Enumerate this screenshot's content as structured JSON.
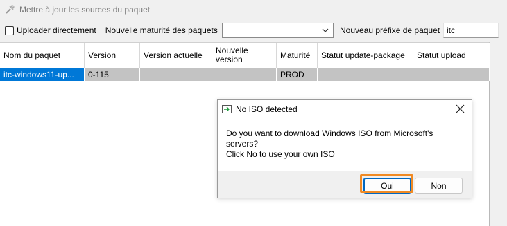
{
  "toolbar": {
    "update_sources_label": "Mettre à jour les sources du paquet",
    "update_icon": "tools-icon"
  },
  "options": {
    "uploader_label": "Uploader directement",
    "uploader_checked": false,
    "maturity_label": "Nouvelle maturité des paquets",
    "maturity_value": "",
    "prefix_label": "Nouveau préfixe de paquet",
    "prefix_value": "itc"
  },
  "grid": {
    "columns": [
      "Nom du paquet",
      "Version",
      "Version actuelle",
      "Nouvelle version",
      "Maturité",
      "Statut update-package",
      "Statut upload"
    ],
    "rows": [
      [
        "itc-windows11-up...",
        "0-115",
        "",
        "",
        "PROD",
        "",
        ""
      ]
    ]
  },
  "dialog": {
    "title": "No ISO detected",
    "line1": "Do you want to download Windows ISO from Microsoft's",
    "line2": "servers?",
    "line3": "Click No to use your own ISO",
    "yes_label": "Oui",
    "no_label": "Non",
    "accent": "#f08a24"
  }
}
